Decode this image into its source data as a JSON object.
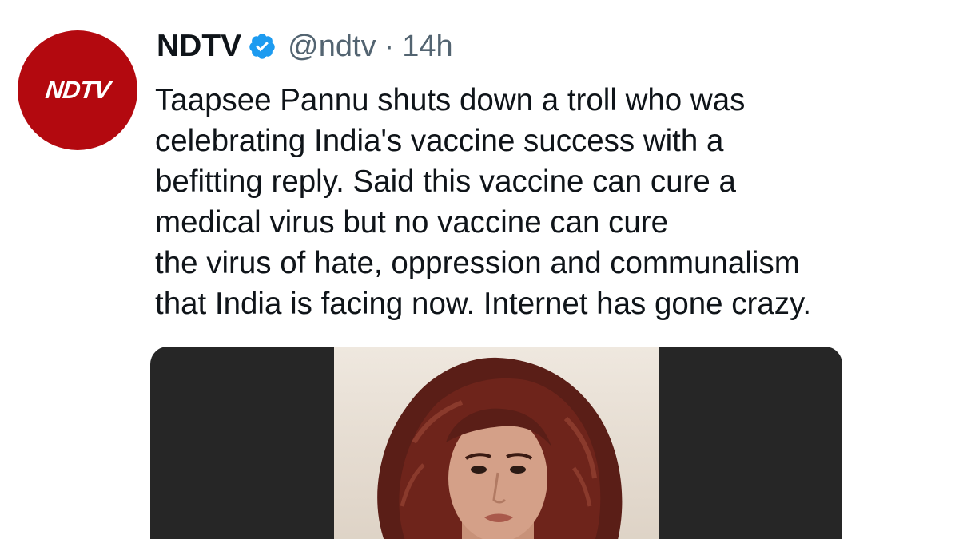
{
  "author": {
    "display_name": "NDTV",
    "handle": "@ndtv",
    "separator": "·",
    "time_ago": "14h",
    "avatar_text": "NDTV",
    "verified": true
  },
  "tweet": {
    "lines": [
      "Taapsee Pannu shuts down a troll who was",
      "celebrating India's vaccine success with a",
      "befitting reply. Said this vaccine can cure a",
      "medical virus but no vaccine can cure",
      "the virus of hate, oppression and communalism",
      "that India is facing now. Internet has gone crazy."
    ]
  },
  "colors": {
    "avatar_bg": "#b3090f",
    "verified_badge": "#1d9bf0",
    "secondary_text": "#536471",
    "media_bg": "#262626"
  },
  "icons": {
    "verified": "verified-badge-icon"
  }
}
